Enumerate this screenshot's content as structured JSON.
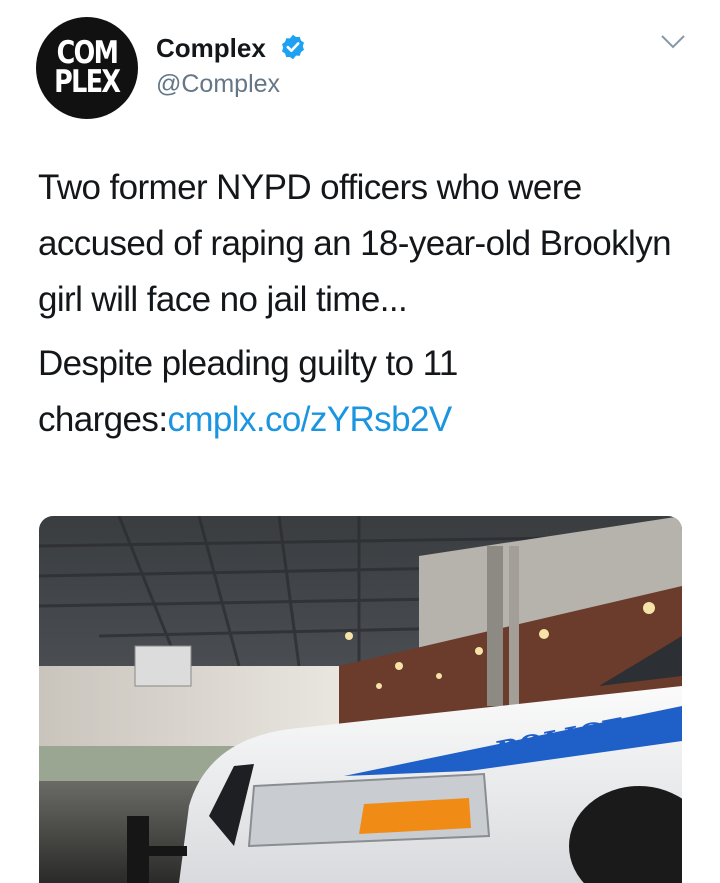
{
  "author": {
    "avatar_line1": "COM",
    "avatar_line2": "PLEX",
    "display_name": "Complex",
    "handle": "@Complex",
    "verified": true
  },
  "tweet": {
    "paragraph1": "Two former NYPD officers who were accused of raping an 18-year-old Brooklyn girl will face no jail time...",
    "paragraph2_text": "Despite pleading guilty to 11 charges:",
    "paragraph2_link": "cmplx.co/zYRsb2V"
  },
  "media": {
    "car_door_text": "POLICE"
  },
  "icons": {
    "verified": "verified-badge-icon",
    "menu": "chevron-down-icon"
  },
  "colors": {
    "link": "#1b95e0",
    "verified": "#1da1f2",
    "handle": "#657786",
    "text": "#14171a"
  }
}
